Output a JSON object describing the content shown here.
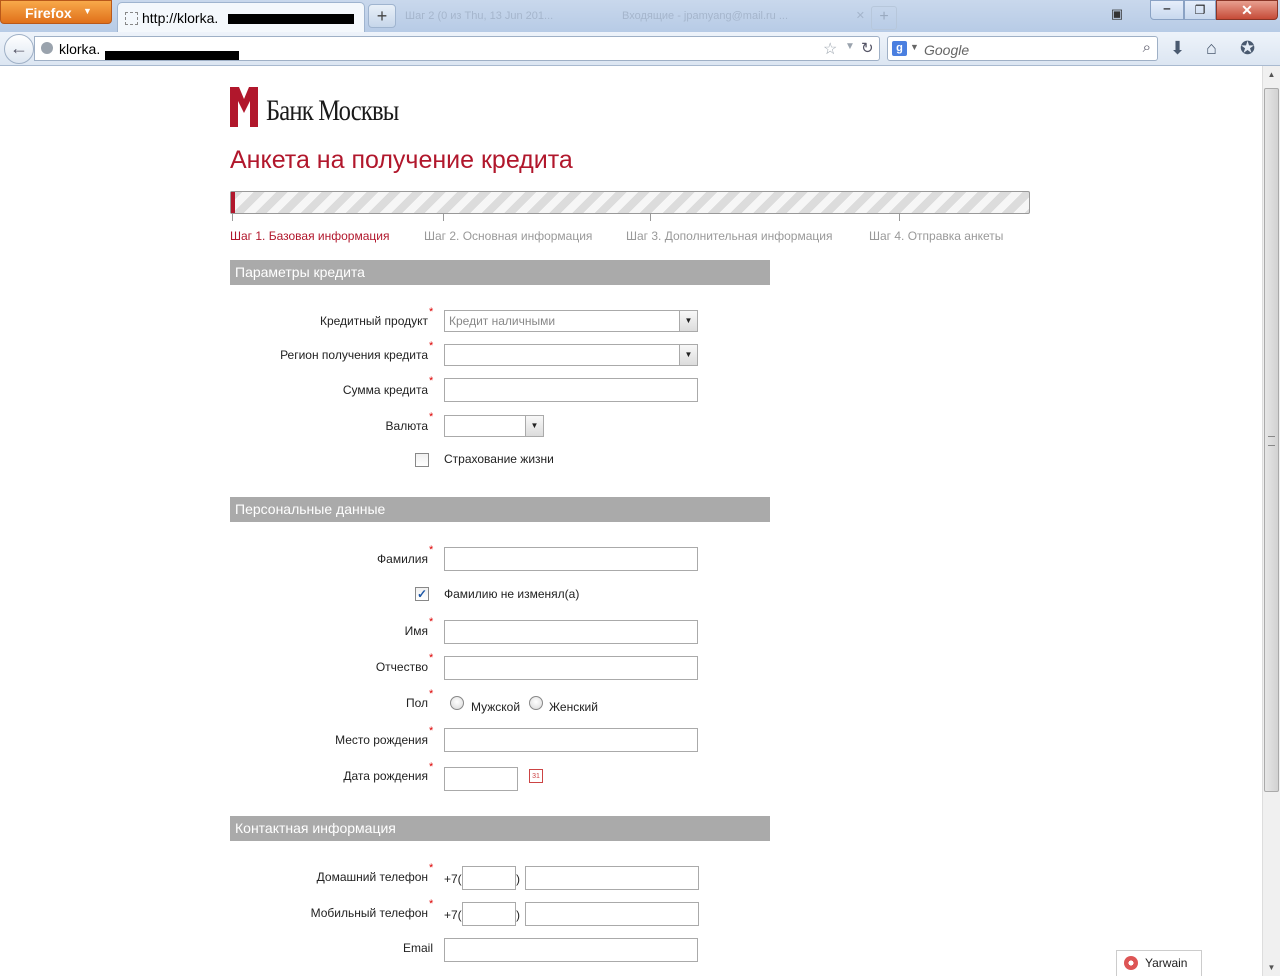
{
  "browser": {
    "firefox_label": "Firefox",
    "active_tab_title": "http://klorka.",
    "new_tab_label": "+",
    "url_text": "klorka.",
    "search_placeholder": "Google",
    "background_tabs": [
      "Шаг 2 (0 из Thu, 13 Jun 201...",
      "Входящие - jpamyang@mail.ru ..."
    ]
  },
  "page": {
    "bank_name": "Банк Москвы",
    "form_title": "Анкета на получение кредита",
    "progress_fraction": 0.005,
    "steps": [
      {
        "label": "Шаг 1. Базовая информация",
        "active": true
      },
      {
        "label": "Шаг 2. Основная информация",
        "active": false
      },
      {
        "label": "Шаг 3. Дополнительная информация",
        "active": false
      },
      {
        "label": "Шаг 4. Отправка анкеты",
        "active": false
      }
    ],
    "required_mark": "*",
    "sections": {
      "credit": {
        "title": "Параметры кредита",
        "product_label": "Кредитный продукт",
        "product_value": "Кредит наличными",
        "region_label": "Регион получения кредита",
        "region_value": "",
        "amount_label": "Сумма кредита",
        "currency_label": "Валюта",
        "insurance_label": "Страхование жизни"
      },
      "personal": {
        "title": "Персональные данные",
        "surname_label": "Фамилия",
        "surname_unchanged_label": "Фамилию не изменял(а)",
        "name_label": "Имя",
        "patronymic_label": "Отчество",
        "gender_label": "Пол",
        "gender_male": "Мужской",
        "gender_female": "Женский",
        "birthplace_label": "Место рождения",
        "birthdate_label": "Дата рождения",
        "calendar_icon_text": "31"
      },
      "contact": {
        "title": "Контактная информация",
        "home_phone_label": "Домашний телефон",
        "mobile_phone_label": "Мобильный телефон",
        "phone_prefix": "+7(",
        "phone_close": ")",
        "email_label": "Email"
      }
    }
  },
  "widgets": {
    "yarwain_label": "Yarwain"
  },
  "colors": {
    "brand_red": "#b1172c",
    "section_grey": "#aaaaaa"
  }
}
